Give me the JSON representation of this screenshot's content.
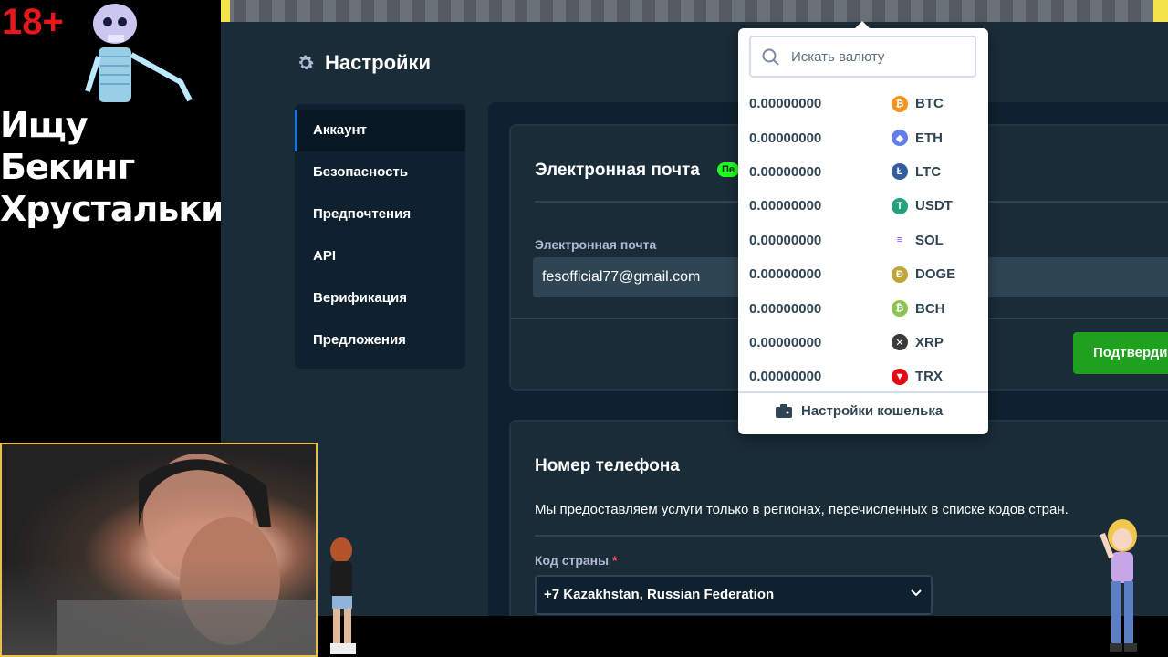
{
  "overlay": {
    "age_badge": "18+",
    "caption": "Ищу Бекинг Хрустальки"
  },
  "settings": {
    "title": "Настройки",
    "nav": [
      {
        "label": "Аккаунт",
        "active": true
      },
      {
        "label": "Безопасность"
      },
      {
        "label": "Предпочтения"
      },
      {
        "label": "API"
      },
      {
        "label": "Верификация"
      },
      {
        "label": "Предложения"
      }
    ]
  },
  "email_card": {
    "title": "Электронная почта",
    "badge": "Пе",
    "field_label": "Электронная почта",
    "value": "fesofficial77@gmail.com",
    "confirm_label": "Подтверди"
  },
  "phone_card": {
    "title": "Номер телефона",
    "description": "Мы предоставляем услуги только в регионах, перечисленных в списке кодов стран.",
    "country_label": "Код страны",
    "required_mark": "*",
    "country_value": "+7 Kazakhstan, Russian Federation"
  },
  "currency_dropdown": {
    "search_placeholder": "Искать валюту",
    "currencies": [
      {
        "amount": "0.00000000",
        "code": "BTC",
        "icon": "bitcoin-icon",
        "color": "#f7931a"
      },
      {
        "amount": "0.00000000",
        "code": "ETH",
        "icon": "ethereum-icon",
        "color": "#627eea"
      },
      {
        "amount": "0.00000000",
        "code": "LTC",
        "icon": "litecoin-icon",
        "color": "#345d9d"
      },
      {
        "amount": "0.00000000",
        "code": "USDT",
        "icon": "tether-icon",
        "color": "#26a17b"
      },
      {
        "amount": "0.00000000",
        "code": "SOL",
        "icon": "solana-icon",
        "color": "#9945ff"
      },
      {
        "amount": "0.00000000",
        "code": "DOGE",
        "icon": "dogecoin-icon",
        "color": "#c2a633"
      },
      {
        "amount": "0.00000000",
        "code": "BCH",
        "icon": "bitcoin-cash-icon",
        "color": "#8dc351"
      },
      {
        "amount": "0.00000000",
        "code": "XRP",
        "icon": "xrp-icon",
        "color": "#3a3a3a"
      },
      {
        "amount": "0.00000000",
        "code": "TRX",
        "icon": "tron-icon",
        "color": "#e50915"
      }
    ],
    "wallet_settings_label": "Настройки кошелька"
  },
  "colors": {
    "app_bg": "#1a2c38",
    "sidebar_bg": "#0f212e",
    "accent_blue": "#1475e1",
    "confirm_green": "#1fa01f",
    "verified_green": "#1fff20"
  }
}
